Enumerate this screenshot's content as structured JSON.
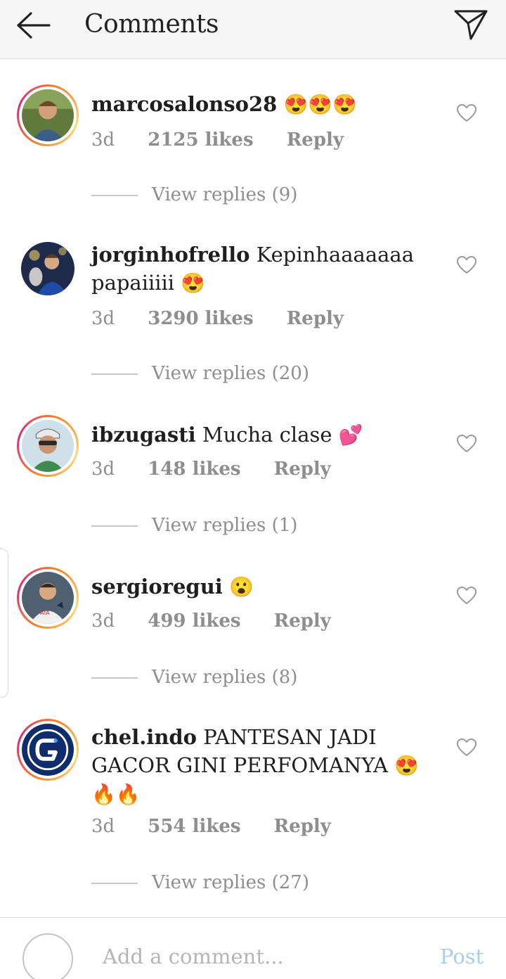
{
  "header": {
    "title": "Comments",
    "back_icon": "arrow-left-icon",
    "send_icon": "paper-plane-icon"
  },
  "comments": [
    {
      "username": "marcosalonso28",
      "text": "",
      "emoji": "😍😍😍",
      "age": "3d",
      "likes": "2125 likes",
      "reply": "Reply",
      "view_replies": "View replies (9)",
      "story_ring": true
    },
    {
      "username": "jorginhofrello",
      "text": "Kepinhaaaaaaa papaiiiii",
      "emoji": "😍",
      "age": "3d",
      "likes": "3290 likes",
      "reply": "Reply",
      "view_replies": "View replies (20)",
      "story_ring": false
    },
    {
      "username": "ibzugasti",
      "text": "Mucha clase",
      "emoji": "💕",
      "age": "3d",
      "likes": "148 likes",
      "reply": "Reply",
      "view_replies": "View replies (1)",
      "story_ring": true
    },
    {
      "username": "sergioregui",
      "text": "",
      "emoji": "😮",
      "age": "3d",
      "likes": "499 likes",
      "reply": "Reply",
      "view_replies": "View replies (8)",
      "story_ring": true
    },
    {
      "username": "chel.indo",
      "text": "PANTESAN JADI GACOR GINI PERFOMANYA",
      "emoji": "😍🔥🔥",
      "age": "3d",
      "likes": "554 likes",
      "reply": "Reply",
      "view_replies": "View replies (27)",
      "story_ring": true
    }
  ],
  "footer": {
    "placeholder": "Add a comment...",
    "post_label": "Post"
  },
  "colors": {
    "meta_gray": "#8e8e8e",
    "post_blue_disabled": "#a9cdf1",
    "ring_orange": "#f58529",
    "ring_pink": "#dd2a7b"
  }
}
